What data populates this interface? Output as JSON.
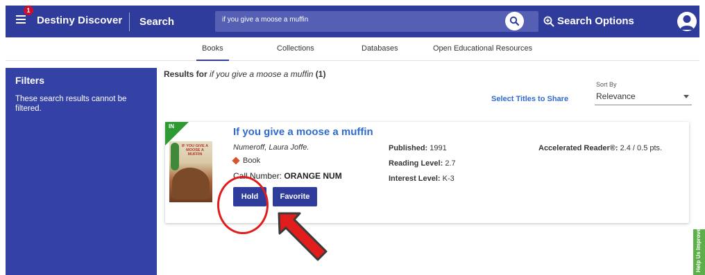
{
  "topbar": {
    "notification_count": "1",
    "app_title": "Destiny Discover",
    "search_label": "Search",
    "search_value": "if you give a moose a muffin",
    "search_options_label": "Search Options"
  },
  "tabs": [
    {
      "label": "Books",
      "active": true
    },
    {
      "label": "Collections",
      "active": false
    },
    {
      "label": "Databases",
      "active": false
    },
    {
      "label": "Open Educational Resources",
      "active": false
    }
  ],
  "sidebar": {
    "title": "Filters",
    "note": "These search results cannot be filtered."
  },
  "results": {
    "prefix": "Results for",
    "query": "if you give a moose a muffin",
    "count": "(1)",
    "select_share_label": "Select Titles to Share",
    "sort_by_label": "Sort By",
    "sort_by_value": "Relevance"
  },
  "book": {
    "availability": "IN",
    "cover_title": "IF YOU GIVE A MOOSE A MUFFIN",
    "title": "If you give a moose a muffin",
    "author": "Numeroff, Laura Joffe.",
    "format": "Book",
    "call_number_label": "Call Number:",
    "call_number_value": "ORANGE NUM",
    "hold_label": "Hold",
    "favorite_label": "Favorite",
    "published_label": "Published:",
    "published_value": "1991",
    "reading_level_label": "Reading Level:",
    "reading_level_value": "2.7",
    "interest_level_label": "Interest Level:",
    "interest_level_value": "K-3",
    "ar_label": "Accelerated Reader®:",
    "ar_value": "2.4 / 0.5 pts."
  },
  "feedback_tab": "Help Us Improve",
  "colors": {
    "primary": "#2f3c9c",
    "link": "#2f6ad0",
    "available": "#2e9a34",
    "annotation": "#e11c1c"
  }
}
